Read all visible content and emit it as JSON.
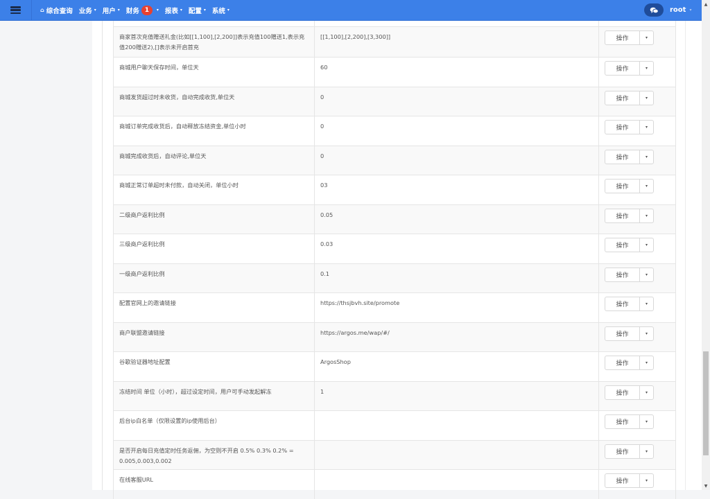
{
  "topbar": {
    "menu_icon": "hamburger-icon",
    "nav": [
      {
        "label": "综合查询",
        "icon": "home-icon",
        "caret": false
      },
      {
        "label": "业务",
        "caret": true
      },
      {
        "label": "用户",
        "caret": true
      },
      {
        "label": "财务",
        "caret": true,
        "badge": "1"
      },
      {
        "label": "报表",
        "caret": true
      },
      {
        "label": "配置",
        "caret": true
      },
      {
        "label": "系统",
        "caret": true
      }
    ],
    "chat_icon": "chat-bubbles-icon",
    "user_name": "root",
    "caret_glyph": "▾",
    "home_glyph": "⌂"
  },
  "table": {
    "action_label": "操作",
    "rows": [
      {
        "name": "商家首次充值赠送礼金(比如[[1,100],[2,200]]表示充值100赠送1,表示充值200赠送2),[]表示未开启首充",
        "value": "[[1,100],[2,200],[3,300]]"
      },
      {
        "name": "商城用户聊天保存时间，单位天",
        "value": "60"
      },
      {
        "name": "商城发货超过时未收货，自动完成收货,单位天",
        "value": "0"
      },
      {
        "name": "商城订单完成收货后，自动释放冻结资金,单位小时",
        "value": "0"
      },
      {
        "name": "商城完成收货后，自动评论,单位天",
        "value": "0"
      },
      {
        "name": "商城正常订单超时未付款，自动关闭，单位小时",
        "value": "03"
      },
      {
        "name": "二级商户返利比例",
        "value": "0.05"
      },
      {
        "name": "三级商户返利比例",
        "value": "0.03"
      },
      {
        "name": "一级商户返利比例",
        "value": "0.1"
      },
      {
        "name": "配置官网上的邀请链接",
        "value": "https://thsjbvh.site/promote"
      },
      {
        "name": "商户联盟邀请链接",
        "value": "https://argos.me/wap/#/"
      },
      {
        "name": "谷歌验证器地址配置",
        "value": "ArgosShop"
      },
      {
        "name": "冻结时间 单位（小时），超过设定时间，用户可手动发起解冻",
        "value": "1"
      },
      {
        "name": "后台ip白名单（仅限设置的ip使用后台）",
        "value": ""
      },
      {
        "name": "是否开启每日充值定时任务返佣，为空则不开启 0.5% 0.3% 0.2% = 0.005,0.003,0.002",
        "value": ""
      },
      {
        "name": "在线客服URL",
        "value": ""
      }
    ]
  },
  "scrollbar": {
    "up_glyph": "▲",
    "down_glyph": "▼"
  }
}
